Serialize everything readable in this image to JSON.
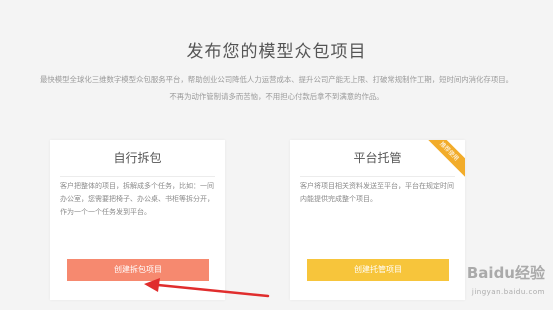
{
  "page": {
    "title": "发布您的模型众包项目",
    "intro_line1": "最快模型全球化三维数字模型众包服务平台，帮助创业公司降低人力运营成本、提升公司产能无上限、打破常规制作工期，短时间内消化存项目。",
    "intro_line2": "不再为动作管制请多而苦恼，不用担心付款后拿不到满意的作品。"
  },
  "cards": {
    "self": {
      "title": "自行拆包",
      "description": "客户把整体的项目，拆解成多个任务，比如：一间办公室，您需要把椅子、办公桌、书柜等拆分开，作为一个一个任务发到平台。",
      "button_label": "创建拆包项目"
    },
    "hosted": {
      "title": "平台托管",
      "description": "客户将项目相关资料发送至平台，平台在规定时间内能提供完成整个项目。",
      "button_label": "创建托管项目",
      "badge": "推荐使用"
    }
  },
  "watermark": {
    "main": "Baidu经验",
    "sub": "jingyan.baidu.com"
  },
  "colors": {
    "background": "#f4f4f4",
    "orange_button": "#f6896f",
    "yellow_button": "#f7c53b",
    "badge": "#f2ac2a",
    "arrow": "#e02d2d"
  }
}
